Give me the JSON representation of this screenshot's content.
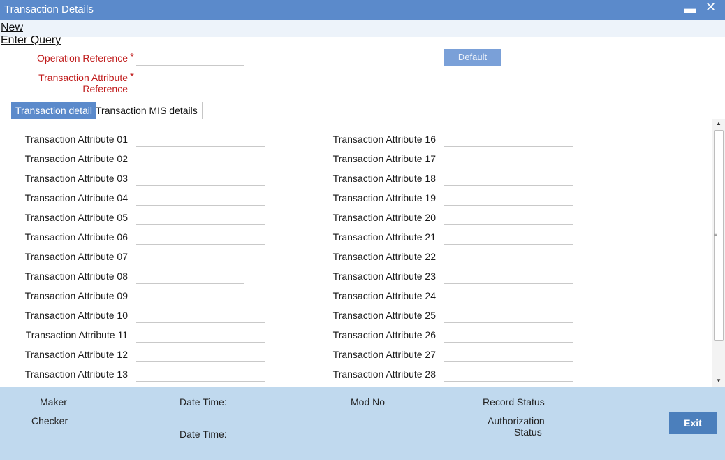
{
  "window": {
    "title": "Transaction Details",
    "minimize_glyph": "▬",
    "close_glyph": "✕"
  },
  "menu": {
    "new_label": "New",
    "query_label": "Enter Query"
  },
  "form": {
    "operation_reference_label": "Operation Reference",
    "transaction_attribute_reference_label_line1": "Transaction Attribute",
    "transaction_attribute_reference_label_line2": "Reference",
    "required_marker": "*",
    "default_button_label": "Default"
  },
  "tabs": [
    {
      "label": "Transaction detail",
      "active": true
    },
    {
      "label": "Transaction MIS details",
      "active": false
    }
  ],
  "attributes_left": [
    "Transaction Attribute 01",
    "Transaction Attribute 02",
    "Transaction Attribute 03",
    "Transaction Attribute 04",
    "Transaction Attribute 05",
    "Transaction Attribute 06",
    "Transaction Attribute 07",
    "Transaction Attribute 08",
    "Transaction Attribute 09",
    "Transaction Attribute 10",
    "Transaction Attribute 11",
    "Transaction Attribute 12",
    "Transaction Attribute 13"
  ],
  "attributes_right": [
    "Transaction Attribute 16",
    "Transaction Attribute 17",
    "Transaction Attribute 18",
    "Transaction Attribute 19",
    "Transaction Attribute 20",
    "Transaction Attribute 21",
    "Transaction Attribute 22",
    "Transaction Attribute 23",
    "Transaction Attribute 24",
    "Transaction Attribute 25",
    "Transaction Attribute 26",
    "Transaction Attribute 27",
    "Transaction Attribute 28"
  ],
  "footer": {
    "maker_label": "Maker",
    "checker_label": "Checker",
    "date_time_label_1": "Date Time:",
    "date_time_label_2": "Date Time:",
    "mod_no_label": "Mod No",
    "record_status_label": "Record Status",
    "authorization_label_line1": "Authorization",
    "authorization_label_line2": "Status",
    "exit_button_label": "Exit"
  },
  "colors": {
    "header_blue": "#5b8acb",
    "required_red": "#c01b1b",
    "footer_blue": "#c0d9ee",
    "exit_blue": "#4b7fbc"
  }
}
